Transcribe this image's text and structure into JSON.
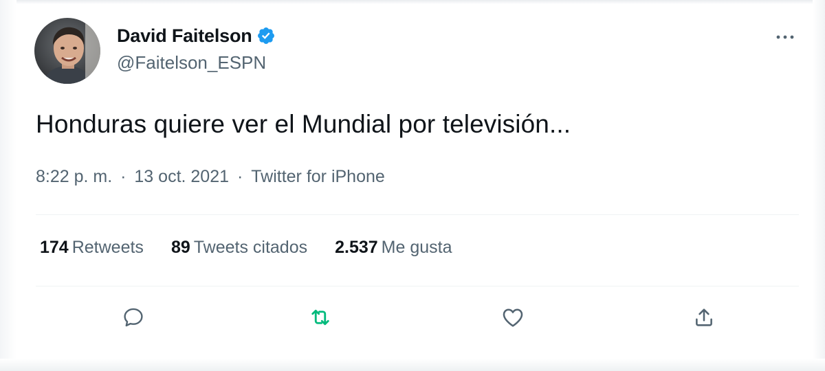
{
  "tweet": {
    "author": {
      "display_name": "David Faitelson",
      "handle": "@Faitelson_ESPN",
      "verified": true
    },
    "text": "Honduras quiere ver el Mundial por televisión...",
    "meta": {
      "time": "8:22 p. m.",
      "separator": "·",
      "date": "13 oct. 2021",
      "source": "Twitter for iPhone"
    },
    "stats": [
      {
        "count": "174",
        "label": "Retweets"
      },
      {
        "count": "89",
        "label": "Tweets citados"
      },
      {
        "count": "2.537",
        "label": "Me gusta"
      }
    ],
    "actions": [
      {
        "icon": "reply-icon"
      },
      {
        "icon": "retweet-icon",
        "active": true
      },
      {
        "icon": "like-icon"
      },
      {
        "icon": "share-icon"
      }
    ]
  },
  "colors": {
    "text_primary": "#0f1419",
    "text_secondary": "#536471",
    "verified_blue": "#1d9bf0",
    "retweet_green": "#00ba7c",
    "divider": "#eff3f4"
  }
}
